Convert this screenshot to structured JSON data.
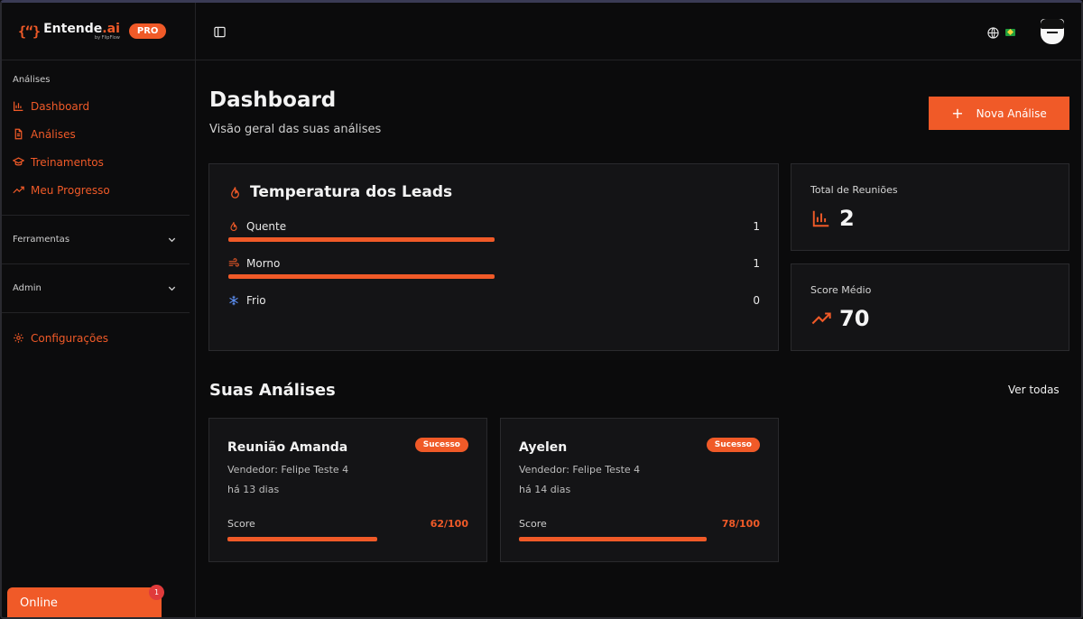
{
  "brand": {
    "name": "Entende",
    "name_accent": ".ai",
    "logo_mark": "{“}",
    "sub": "by FlipFlow",
    "badge": "PRO"
  },
  "sidebar": {
    "analises_title": "Análises",
    "items": [
      {
        "label": "Dashboard",
        "icon": "bar-chart-icon"
      },
      {
        "label": "Análises",
        "icon": "document-icon"
      },
      {
        "label": "Treinamentos",
        "icon": "graduation-cap-icon"
      },
      {
        "label": "Meu Progresso",
        "icon": "trending-up-icon"
      }
    ],
    "tools_title": "Ferramentas",
    "admin_title": "Admin",
    "settings_label": "Configurações"
  },
  "online": {
    "label": "Online",
    "notification_count": "1"
  },
  "page": {
    "title": "Dashboard",
    "subtitle": "Visão geral das suas análises",
    "new_button": "Nova Análise"
  },
  "leads": {
    "title": "Temperatura dos Leads",
    "rows": [
      {
        "label": "Quente",
        "count": "1",
        "fraction": 0.5
      },
      {
        "label": "Morno",
        "count": "1",
        "fraction": 0.5
      },
      {
        "label": "Frio",
        "count": "0",
        "fraction": 0
      }
    ]
  },
  "stats": {
    "total_label": "Total de Reuniões",
    "total_value": "2",
    "score_label": "Score Médio",
    "score_value": "70"
  },
  "analyses": {
    "title": "Suas Análises",
    "see_all": "Ver todas",
    "items": [
      {
        "title": "Reunião Amanda",
        "status": "Sucesso",
        "seller": "Vendedor: Felipe Teste 4",
        "date": "há 13 dias",
        "score_label": "Score",
        "score_text": "62/100",
        "score": 62
      },
      {
        "title": "Ayelen",
        "status": "Sucesso",
        "seller": "Vendedor: Felipe Teste 4",
        "date": "há 14 dias",
        "score_label": "Score",
        "score_text": "78/100",
        "score": 78
      }
    ]
  },
  "colors": {
    "accent": "#f05a28",
    "background": "#0b0b0c",
    "card": "#141416",
    "cold": "#5b8def"
  }
}
